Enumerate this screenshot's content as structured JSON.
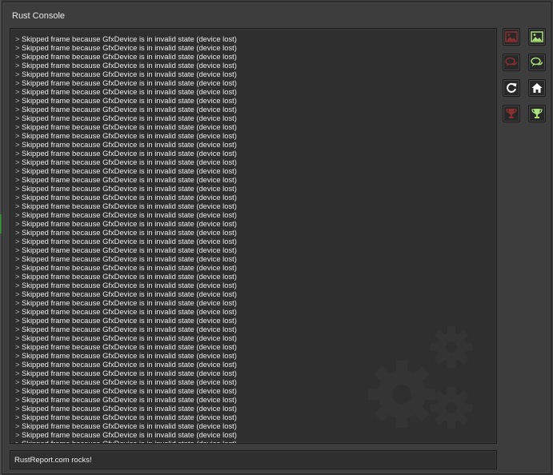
{
  "window": {
    "title": "Rust Console"
  },
  "console": {
    "prompt_glyph": ">",
    "lines": [
      "Skipped frame because GfxDevice is in invalid state (device lost)",
      "Skipped frame because GfxDevice is in invalid state (device lost)",
      "Skipped frame because GfxDevice is in invalid state (device lost)",
      "Skipped frame because GfxDevice is in invalid state (device lost)",
      "Skipped frame because GfxDevice is in invalid state (device lost)",
      "Skipped frame because GfxDevice is in invalid state (device lost)",
      "Skipped frame because GfxDevice is in invalid state (device lost)",
      "Skipped frame because GfxDevice is in invalid state (device lost)",
      "Skipped frame because GfxDevice is in invalid state (device lost)",
      "Skipped frame because GfxDevice is in invalid state (device lost)",
      "Skipped frame because GfxDevice is in invalid state (device lost)",
      "Skipped frame because GfxDevice is in invalid state (device lost)",
      "Skipped frame because GfxDevice is in invalid state (device lost)",
      "Skipped frame because GfxDevice is in invalid state (device lost)",
      "Skipped frame because GfxDevice is in invalid state (device lost)",
      "Skipped frame because GfxDevice is in invalid state (device lost)",
      "Skipped frame because GfxDevice is in invalid state (device lost)",
      "Skipped frame because GfxDevice is in invalid state (device lost)",
      "Skipped frame because GfxDevice is in invalid state (device lost)",
      "Skipped frame because GfxDevice is in invalid state (device lost)",
      "Skipped frame because GfxDevice is in invalid state (device lost)",
      "Skipped frame because GfxDevice is in invalid state (device lost)",
      "Skipped frame because GfxDevice is in invalid state (device lost)",
      "Skipped frame because GfxDevice is in invalid state (device lost)",
      "Skipped frame because GfxDevice is in invalid state (device lost)",
      "Skipped frame because GfxDevice is in invalid state (device lost)",
      "Skipped frame because GfxDevice is in invalid state (device lost)",
      "Skipped frame because GfxDevice is in invalid state (device lost)",
      "Skipped frame because GfxDevice is in invalid state (device lost)",
      "Skipped frame because GfxDevice is in invalid state (device lost)",
      "Skipped frame because GfxDevice is in invalid state (device lost)",
      "Skipped frame because GfxDevice is in invalid state (device lost)",
      "Skipped frame because GfxDevice is in invalid state (device lost)",
      "Skipped frame because GfxDevice is in invalid state (device lost)",
      "Skipped frame because GfxDevice is in invalid state (device lost)",
      "Skipped frame because GfxDevice is in invalid state (device lost)",
      "Skipped frame because GfxDevice is in invalid state (device lost)",
      "Skipped frame because GfxDevice is in invalid state (device lost)",
      "Skipped frame because GfxDevice is in invalid state (device lost)",
      "Skipped frame because GfxDevice is in invalid state (device lost)",
      "Skipped frame because GfxDevice is in invalid state (device lost)",
      "Skipped frame because GfxDevice is in invalid state (device lost)",
      "Skipped frame because GfxDevice is in invalid state (device lost)",
      "Skipped frame because GfxDevice is in invalid state (device lost)",
      "Skipped frame because GfxDevice is in invalid state (device lost)",
      "Skipped frame because GfxDevice is in invalid state (device lost)",
      "Skipped frame because GfxDevice is in invalid state (device lost)"
    ]
  },
  "input": {
    "value": "RustReport.com rocks!"
  },
  "toolbar": {
    "buttons": [
      {
        "id": "image-dark",
        "icon": "image-icon",
        "state": "inactive",
        "color": "#8a3030"
      },
      {
        "id": "image-light",
        "icon": "image-icon",
        "state": "active",
        "color": "#a8e07a"
      },
      {
        "id": "chat-dark",
        "icon": "chat-bubbles-icon",
        "state": "inactive",
        "color": "#8a3030"
      },
      {
        "id": "chat-light",
        "icon": "chat-bubbles-icon",
        "state": "active",
        "color": "#a8e07a"
      },
      {
        "id": "refresh",
        "icon": "refresh-icon",
        "state": "active",
        "color": "#ffffff"
      },
      {
        "id": "home",
        "icon": "home-icon",
        "state": "active",
        "color": "#ffffff"
      },
      {
        "id": "trophy-dark",
        "icon": "trophy-icon",
        "state": "inactive",
        "color": "#8a3030"
      },
      {
        "id": "trophy-light",
        "icon": "trophy-icon",
        "state": "active",
        "color": "#a8e07a"
      }
    ]
  },
  "colors": {
    "inactive_icon": "#8a3030",
    "active_icon": "#a8e07a",
    "white_icon": "#ffffff",
    "left_edge_accent": "#3c8a3c"
  }
}
